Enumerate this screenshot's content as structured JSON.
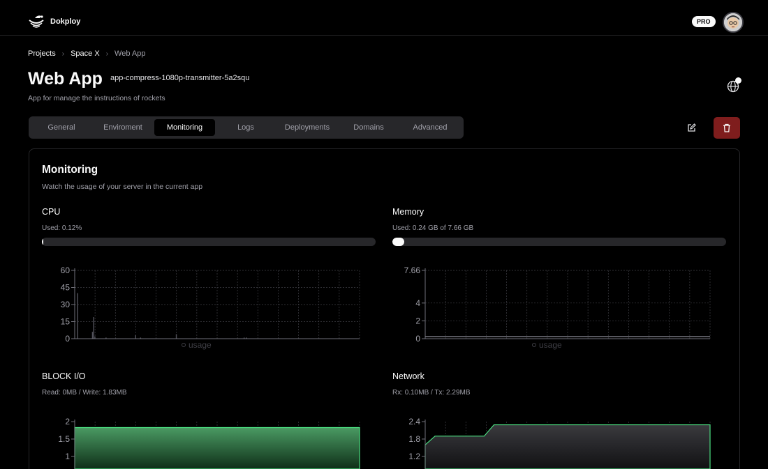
{
  "brand": {
    "name": "Dokploy"
  },
  "header": {
    "badge": "PRO"
  },
  "breadcrumb": [
    {
      "label": "Projects"
    },
    {
      "label": "Space X"
    },
    {
      "label": "Web App"
    }
  ],
  "app": {
    "title": "Web App",
    "name": "app-compress-1080p-transmitter-5a2squ",
    "description": "App for manage the instructions of rockets"
  },
  "tabs": [
    {
      "label": "General"
    },
    {
      "label": "Enviroment"
    },
    {
      "label": "Monitoring",
      "active": true
    },
    {
      "label": "Logs"
    },
    {
      "label": "Deployments"
    },
    {
      "label": "Domains"
    },
    {
      "label": "Advanced"
    }
  ],
  "monitoring": {
    "title": "Monitoring",
    "description": "Watch the usage of your server in the current app",
    "cpu": {
      "label": "CPU",
      "used_text": "Used: 0.12%",
      "fraction": 0.0012
    },
    "memory": {
      "label": "Memory",
      "used_text": "Used: 0.24 GB of 7.66 GB",
      "fraction": 0.031
    },
    "block_io": {
      "label": "BLOCK I/O",
      "text": "Read: 0MB / Write: 1.83MB"
    },
    "network": {
      "label": "Network",
      "text": "Rx: 0.10MB / Tx: 2.29MB"
    }
  },
  "colors": {
    "danger": "#7f1d1d",
    "io_fill": "#4ade80"
  },
  "chart_data": [
    {
      "type": "bar",
      "title": "CPU",
      "ylim": [
        0,
        60
      ],
      "yticks": [
        "0",
        "15",
        "30",
        "45",
        "60"
      ],
      "legend": "usage",
      "grid": true,
      "values": [
        0,
        0,
        40,
        0,
        0,
        0,
        0,
        0,
        0,
        0,
        0,
        0,
        0,
        0,
        6,
        19,
        2,
        0,
        0,
        0,
        0,
        0,
        0,
        0,
        0,
        1,
        0,
        0,
        0,
        0,
        0,
        0,
        0,
        0,
        0,
        0,
        0,
        0,
        0,
        0,
        0,
        0,
        0,
        0,
        0,
        0,
        0,
        0,
        0,
        3,
        0,
        0,
        0,
        1,
        0,
        0,
        0,
        0,
        0,
        0,
        0,
        0,
        0,
        0,
        0,
        0,
        0,
        0,
        0,
        0,
        0,
        0,
        0,
        0,
        0,
        0,
        0,
        0,
        0,
        0,
        0,
        0,
        4,
        0,
        0,
        0,
        0,
        0,
        0,
        0,
        0,
        0,
        0,
        0,
        0,
        0,
        0,
        0,
        0,
        0,
        0,
        0,
        0,
        0,
        0,
        0,
        0,
        0,
        0,
        0,
        0,
        0,
        0,
        0,
        0,
        0,
        0,
        0,
        0,
        0,
        0,
        0,
        0,
        0,
        0,
        0,
        0,
        0,
        0,
        0,
        0,
        0,
        0,
        0,
        0,
        0,
        0,
        1,
        0,
        1,
        0,
        0,
        0,
        0,
        0,
        0,
        0,
        0,
        0,
        0,
        0,
        0,
        0,
        0,
        0,
        0,
        0,
        0,
        0,
        0,
        0,
        0,
        0,
        0,
        0,
        0,
        0,
        0,
        0,
        0,
        0,
        0,
        0,
        0,
        0,
        0,
        0,
        0,
        0,
        0,
        0,
        0,
        0,
        0,
        0,
        0,
        0,
        0,
        0,
        0,
        0,
        0,
        0,
        0,
        0,
        0,
        0,
        0,
        0,
        0,
        0,
        0,
        0,
        0,
        0,
        0,
        0,
        0,
        0,
        0,
        0,
        0,
        0,
        0,
        0,
        0,
        0,
        0,
        0,
        0,
        0,
        0,
        0,
        0,
        0,
        0,
        0,
        0,
        0,
        0,
        0
      ]
    },
    {
      "type": "line",
      "title": "Memory",
      "ylim": [
        0,
        7.66
      ],
      "yticks": [
        "0",
        "2",
        "4",
        "7.66"
      ],
      "legend": "usage",
      "grid": true,
      "values": [
        0.24,
        0.24,
        0.24,
        0.24,
        0.24,
        0.24,
        0.24,
        0.24,
        0.24,
        0.24
      ]
    },
    {
      "type": "area",
      "title": "BLOCK I/O",
      "ylim": [
        0,
        2
      ],
      "yticks": [
        "1",
        "1.5",
        "2"
      ],
      "values": [
        1.83,
        1.83,
        1.83,
        1.83,
        1.83,
        1.83,
        1.83,
        1.83,
        1.83,
        1.83
      ]
    },
    {
      "type": "area",
      "title": "Network",
      "ylim": [
        0,
        2.4
      ],
      "yticks": [
        "1.2",
        "1.8",
        "2.4"
      ],
      "values": [
        1.6,
        1.9,
        1.9,
        1.9,
        1.9,
        1.9,
        1.9,
        2.29,
        2.29,
        2.29,
        2.29,
        2.29,
        2.29,
        2.29,
        2.29,
        2.29,
        2.29,
        2.29,
        2.29,
        2.29,
        2.29,
        2.29,
        2.29,
        2.29,
        2.29,
        2.29,
        2.29,
        2.29,
        2.29,
        2.29
      ]
    }
  ]
}
